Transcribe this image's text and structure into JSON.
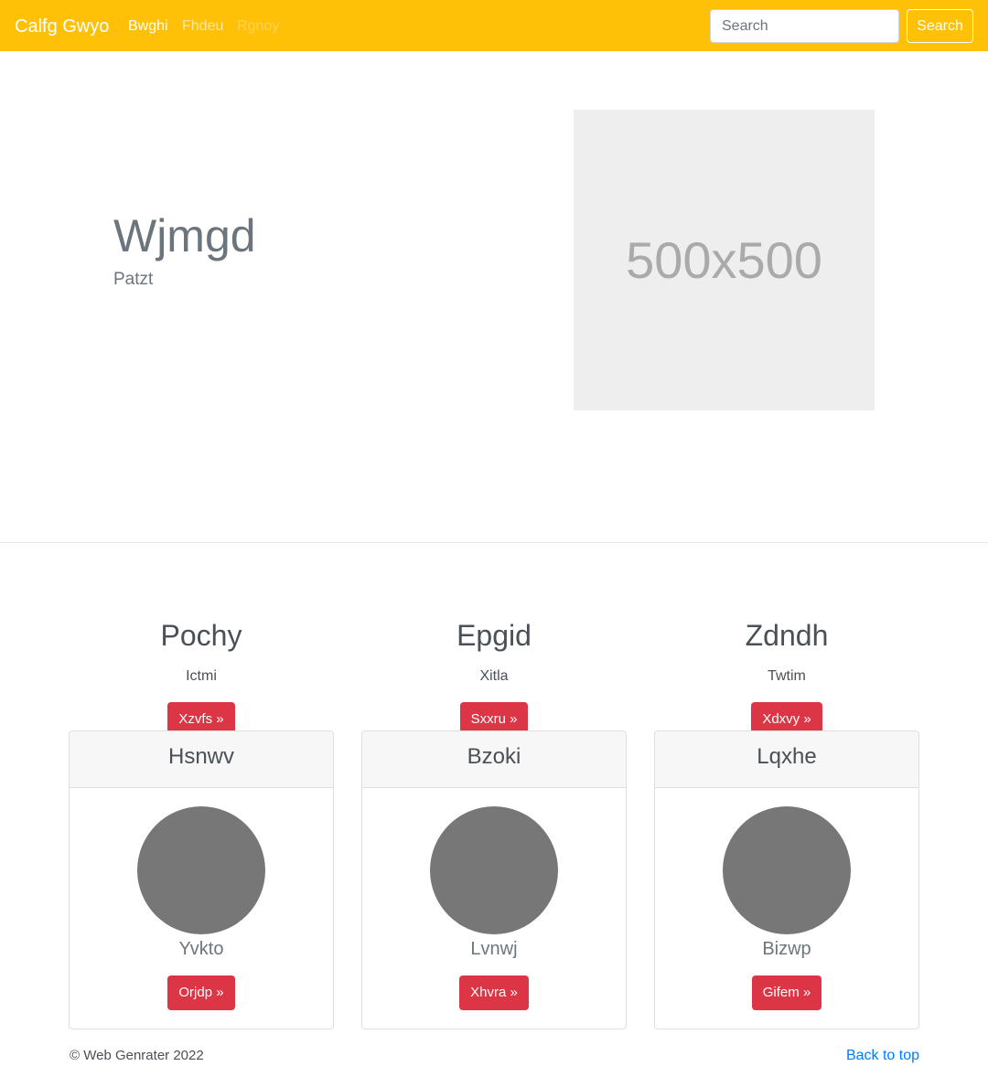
{
  "navbar": {
    "brand": "Calfg Gwyo",
    "links": [
      "Bwghi",
      "Fhdeu",
      "Rgnoy"
    ],
    "search_placeholder": "Search",
    "search_button": "Search"
  },
  "hero": {
    "title": "Wjmgd",
    "subtitle": "Patzt",
    "image_label": "500x500"
  },
  "features": [
    {
      "title": "Pochy",
      "text": "Ictmi",
      "button": "Xzvfs »"
    },
    {
      "title": "Epgid",
      "text": "Xitla",
      "button": "Sxxru »"
    },
    {
      "title": "Zdndh",
      "text": "Twtim",
      "button": "Xdxvy »"
    }
  ],
  "cards": [
    {
      "header": "Hsnwv",
      "name": "Yvkto",
      "button": "Orjdp »"
    },
    {
      "header": "Bzoki",
      "name": "Lvnwj",
      "button": "Xhvra »"
    },
    {
      "header": "Lqxhe",
      "name": "Bizwp",
      "button": "Gifem »"
    }
  ],
  "footer": {
    "copyright": "© Web Genrater 2022",
    "back_to_top": "Back to top"
  },
  "colors": {
    "navbar": "#ffc107",
    "danger": "#dc3545",
    "link": "#007bff",
    "avatar": "#777777"
  }
}
